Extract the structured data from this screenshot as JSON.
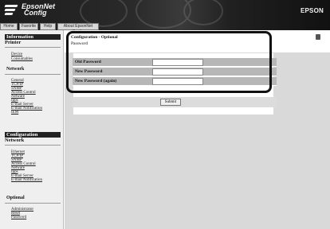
{
  "app": {
    "title_line1": "EpsonNet",
    "title_line2": "Config",
    "brand": "EPSON"
  },
  "tabs": [
    "Home",
    "Favorite",
    "Help",
    "About EpsonNet Config"
  ],
  "sidebar": {
    "information": {
      "heading": "Information",
      "sub": "Printer",
      "links": [
        "Device",
        "Consumables"
      ]
    },
    "info_network": {
      "title": "Network",
      "links": [
        "General",
        "TCP/IP",
        "SNMP",
        "Access Control",
        "Netware",
        "Ipps",
        "E-mail Server",
        "E-mail Notification",
        "IEM"
      ]
    },
    "configuration": {
      "heading": "Configuration",
      "sub": "Network",
      "links": [
        "Ethernet",
        "TCP/IP",
        "SNMP",
        "Access Control",
        "Netware",
        "Ipps",
        "E-mail Server",
        "E-mail Notification"
      ]
    },
    "optional": {
      "title": "Optional",
      "links": [
        "Administrator",
        "Reset",
        "Password"
      ]
    }
  },
  "main": {
    "title": "Configuration - Optional",
    "subtitle": "Password",
    "form": {
      "fields": [
        {
          "label": "Old Password",
          "value": ""
        },
        {
          "label": "New Password",
          "value": ""
        },
        {
          "label": "New Password (again)",
          "value": ""
        }
      ],
      "submit_label": "Submit"
    }
  }
}
